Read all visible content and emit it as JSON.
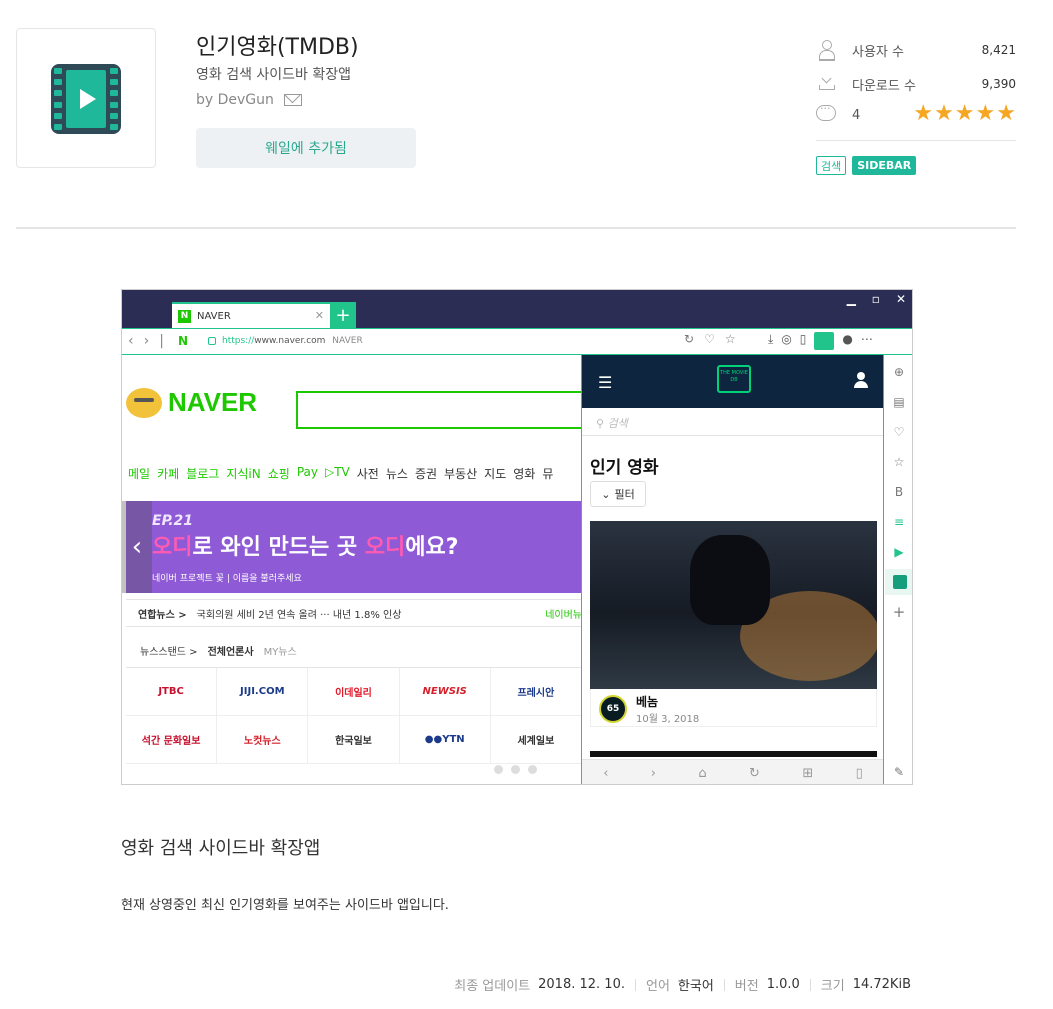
{
  "app": {
    "title": "인기영화(TMDB)",
    "subtitle": "영화 검색 사이드바 확장앱",
    "byline": "by DevGun",
    "install_status": "웨일에 추가됨"
  },
  "stats": {
    "users_label": "사용자 수",
    "users_value": "8,421",
    "downloads_label": "다운로드 수",
    "downloads_value": "9,390",
    "reviews_value": "4",
    "rating_stars": 5
  },
  "tags": [
    "검색",
    "SIDEBAR"
  ],
  "screenshot": {
    "tab_title": "NAVER",
    "url_https": "https://",
    "url_host": "www.naver.com",
    "url_title": "NAVER",
    "naver_logo": "NAVER",
    "naver_menu": [
      "메일",
      "카페",
      "블로그",
      "지식iN",
      "쇼핑",
      "Pay",
      "▷TV",
      "사전",
      "뉴스",
      "증권",
      "부동산",
      "지도",
      "영화",
      "뮤"
    ],
    "banner_episode": "EP.21",
    "banner_headline_pre": "오디",
    "banner_headline_mid": "로 와인 만드는 곳 ",
    "banner_headline_post": "오디",
    "banner_headline_end": "에요?",
    "banner_sub": "네이버 프로젝트 꽃 | 이름을 불러주세요",
    "news_source": "연합뉴스 >",
    "news_headline": "국회의원 세비 2년 연속 올려 ··· 내년 1.8% 인상",
    "news_more": "네이버뉴",
    "stand_label": "뉴스스탠드 >",
    "stand_all": "전체언론사",
    "stand_my": "MY뉴스",
    "press": [
      "JTBC",
      "JIJI.COM",
      "이데일리",
      "NEWSIS",
      "프레시안",
      "석간 문화일보",
      "노컷뉴스",
      "한국일보",
      "●●YTN",
      "세계일보"
    ],
    "side_search_placeholder": "검색",
    "side_title": "인기 영화",
    "filter_label": "필터",
    "movie_title": "베놈",
    "movie_date": "10월 3, 2018",
    "movie_score": "65",
    "tmdb_logo": "THE MOVIE DB"
  },
  "description": {
    "title": "영화 검색 사이드바 확장앱",
    "text": "현재 상영중인 최신 인기영화를 보여주는 사이드바 앱입니다."
  },
  "meta": {
    "updated_label": "최종 업데이트",
    "updated_value": "2018. 12. 10.",
    "lang_label": "언어",
    "lang_value": "한국어",
    "version_label": "버전",
    "version_value": "1.0.0",
    "size_label": "크기",
    "size_value": "14.72KiB"
  },
  "colors": {
    "accent": "#20b89b",
    "star": "#f5a623",
    "naver_green": "#1ec800",
    "tmdb_navy": "#0d253f"
  }
}
